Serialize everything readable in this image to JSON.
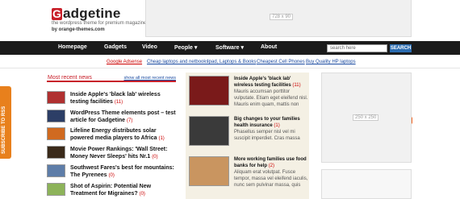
{
  "header": {
    "logo_letter": "G",
    "logo_rest": "adgetine",
    "tagline": "the wordpress theme for premium magazine",
    "byline": "by orange-themes.com",
    "banner_label": "728 x 90"
  },
  "nav": {
    "items": [
      {
        "label": "Homepage"
      },
      {
        "label": "Gadgets"
      },
      {
        "label": "Video"
      },
      {
        "label": "People ▾"
      },
      {
        "label": "Software ▾"
      },
      {
        "label": "About"
      }
    ],
    "search_value": "search here",
    "search_button": "SEARCH"
  },
  "subnav": {
    "items": [
      {
        "label": "Google Adsense"
      },
      {
        "label": "Cheap laptops and netbooks"
      },
      {
        "label": "Ipad, Laptops & Books"
      },
      {
        "label": "Cheapest Cell Phones"
      },
      {
        "label": "Buy Quality HP laptops"
      }
    ]
  },
  "social": {
    "colors": [
      "#3b5998",
      "#33ccff",
      "#3b5998",
      "#f26522"
    ],
    "icons": [
      "myspace-icon",
      "twitter-icon",
      "facebook-icon",
      "rss-icon"
    ]
  },
  "rss_tab": "SUBSCRIBE TO RSS",
  "recent": {
    "heading": "Most recent news",
    "show_all": "show all most recent news",
    "items": [
      {
        "title": "Inside Apple's 'black lab' wireless testing facilities",
        "count": "(11)"
      },
      {
        "title": "WordPress Theme elements post – test article for Gadgetine",
        "count": "(7)"
      },
      {
        "title": "Lifeline Energy distributes solar powered media players to Africa",
        "count": "(1)"
      },
      {
        "title": "Movie Power Rankings: 'Wall Street: Money Never Sleeps' hits Nr.1",
        "count": "(0)"
      },
      {
        "title": "Southwest Fares's best for mountains: The Pyrenees",
        "count": "(0)"
      },
      {
        "title": "Shot of Aspirin: Potential New Treatment for Migraines?",
        "count": "(0)"
      }
    ]
  },
  "featured": {
    "items": [
      {
        "title": "Inside Apple's 'black lab' wireless testing facilities",
        "count": "(11)",
        "excerpt": "Mauris accumsan porttitor vulputate. Etiam eget eleifend nisl. Mauris enim quam, mattis non"
      },
      {
        "title": "Big changes to your families health insurance",
        "count": "(1)",
        "excerpt": "Phasellus semper nisl vel mi suscipit imperdiet. Cras massa"
      },
      {
        "title": "More working families use food banks for help",
        "count": "(2)",
        "excerpt": "Aliquam erat volutpat. Fusce tempor, massa vel eleifend iaculis, nunc sem pulvinar massa, quis"
      }
    ]
  },
  "ads": {
    "sidebar_label": "250 x 250"
  }
}
